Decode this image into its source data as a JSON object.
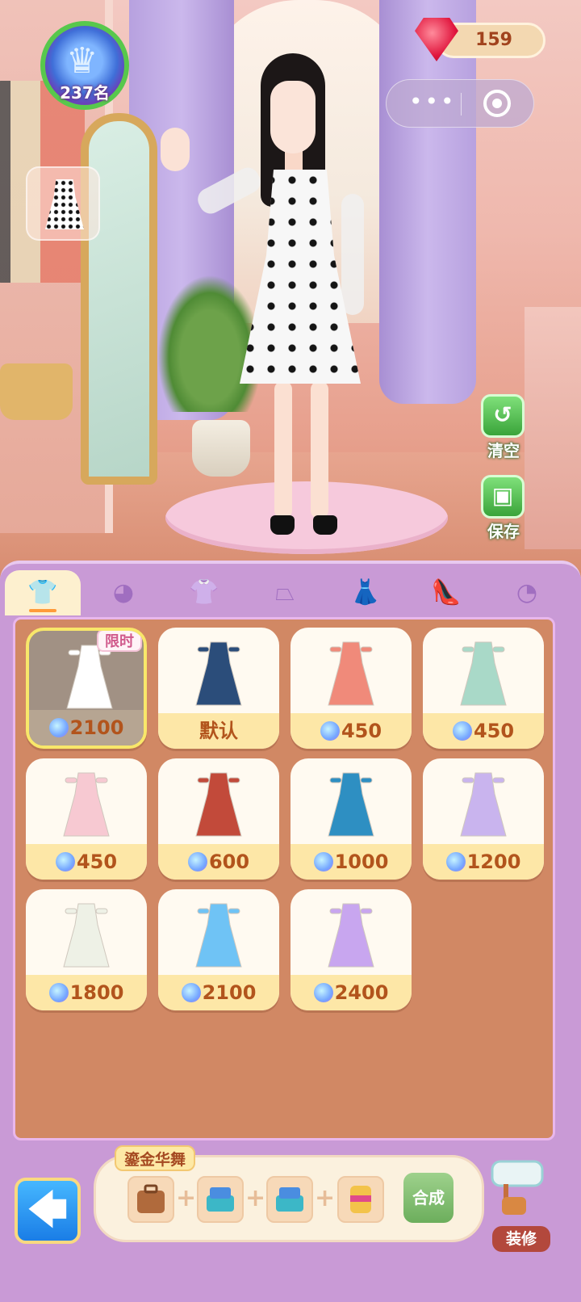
{
  "hud": {
    "rank_label": "237名",
    "gems": "159",
    "menu_dots": "•••"
  },
  "side_buttons": {
    "clear_label": "清空",
    "save_label": "保存"
  },
  "tabs": [
    {
      "icon": "outfit-icon",
      "glyph": "👕"
    },
    {
      "icon": "hair-icon",
      "glyph": "◕"
    },
    {
      "icon": "top-icon",
      "glyph": "👚"
    },
    {
      "icon": "skirt-icon",
      "glyph": "⏢"
    },
    {
      "icon": "dress-icon",
      "glyph": "👗"
    },
    {
      "icon": "heels-icon",
      "glyph": "👠"
    },
    {
      "icon": "accessory-icon",
      "glyph": "◔"
    }
  ],
  "items": [
    {
      "price": "2100",
      "badge": "限时",
      "selected": true,
      "color": "#ffffff"
    },
    {
      "price": "默认",
      "color": "#2b4d7a"
    },
    {
      "price": "450",
      "color": "#f08a7a"
    },
    {
      "price": "450",
      "color": "#a9d9c8"
    },
    {
      "price": "450",
      "color": "#f7c9d2"
    },
    {
      "price": "600",
      "color": "#c24a3a"
    },
    {
      "price": "1000",
      "color": "#2e8fc2"
    },
    {
      "price": "1200",
      "color": "#c9b4ee"
    },
    {
      "price": "1800",
      "color": "#eef1e6"
    },
    {
      "price": "2100",
      "color": "#6fc3f5"
    },
    {
      "price": "2400",
      "color": "#c8a6ef"
    }
  ],
  "recipe": {
    "title": "鎏金华舞",
    "plus": "+",
    "compose_label": "合成"
  },
  "decor_label": "装修",
  "back_glyph": "🡄"
}
